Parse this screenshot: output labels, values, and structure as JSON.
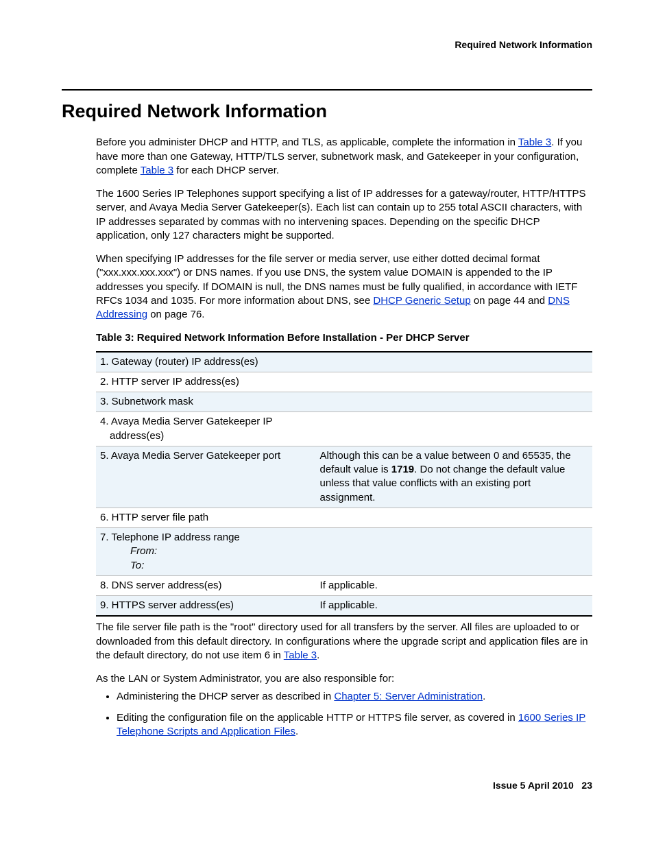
{
  "header": {
    "right": "Required Network Information"
  },
  "heading": "Required Network Information",
  "para1": {
    "t1": "Before you administer DHCP and HTTP, and TLS, as applicable, complete the information in ",
    "link1": "Table 3",
    "t2": ". If you have more than one Gateway, HTTP/TLS server, subnetwork mask, and Gatekeeper in your configuration, complete ",
    "link2": "Table 3",
    "t3": " for each DHCP server."
  },
  "para2": "The 1600 Series IP Telephones support specifying a list of IP addresses for a gateway/router, HTTP/HTTPS server, and Avaya Media Server Gatekeeper(s). Each list can contain up to 255 total ASCII characters, with IP addresses separated by commas with no intervening spaces. Depending on the specific DHCP application, only 127 characters might be supported.",
  "para3": {
    "t1": "When specifying IP addresses for the file server or media server, use either dotted decimal format (\"xxx.xxx.xxx.xxx\") or DNS names. If you use DNS, the system value DOMAIN is appended to the IP addresses you specify. If DOMAIN is null, the DNS names must be fully qualified, in accordance with IETF RFCs 1034 and 1035. For more information about DNS, see ",
    "link1": "DHCP Generic Setup",
    "t2": " on page 44 and ",
    "link2": "DNS Addressing",
    "t3": " on page 76."
  },
  "table": {
    "caption": "Table 3: Required Network Information Before Installation - Per DHCP Server",
    "rows": [
      {
        "left": "1. Gateway (router) IP address(es)",
        "right": ""
      },
      {
        "left": "2. HTTP server IP address(es)",
        "right": ""
      },
      {
        "left": "3. Subnetwork mask",
        "right": ""
      },
      {
        "left": "4. Avaya Media Server Gatekeeper IP address(es)",
        "right": ""
      },
      {
        "left": "5. Avaya Media Server Gatekeeper port",
        "right_pre": "Although this can be a value between 0 and 65535, the default value is ",
        "right_bold": "1719",
        "right_post": ". Do not change the default value unless that value conflicts with an existing port assignment."
      },
      {
        "left": "6. HTTP server file path",
        "right": ""
      },
      {
        "left": "7. Telephone IP address range",
        "from": "From",
        "to": "To",
        "right": ""
      },
      {
        "left": "8. DNS server address(es)",
        "right": "If applicable."
      },
      {
        "left": "9. HTTPS server address(es)",
        "right": "If applicable."
      }
    ]
  },
  "para4": {
    "t1": "The file server file path is the \"root\" directory used for all transfers by the server. All files are uploaded to or downloaded from this default directory. In configurations where the upgrade script and application files are in the default directory, do not use item 6 in ",
    "link": "Table 3",
    "t2": "."
  },
  "para5": "As the LAN or System Administrator, you are also responsible for:",
  "bullets": [
    {
      "t1": "Administering the DHCP server as described in ",
      "link": "Chapter 5: Server Administration",
      "t2": "."
    },
    {
      "t1": "Editing the configuration file on the applicable HTTP or HTTPS file server, as covered in ",
      "link": "1600 Series IP Telephone Scripts and Application Files",
      "t2": "."
    }
  ],
  "footer": {
    "issue": "Issue 5   April 2010",
    "page": "23"
  }
}
